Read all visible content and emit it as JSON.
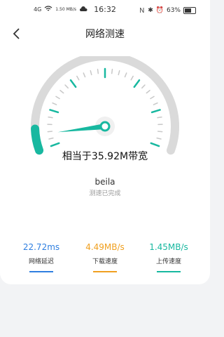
{
  "status_bar": {
    "signal": "4G",
    "net_speed": "1.50 MB/s",
    "time": "16:32",
    "icons": [
      "nfc-icon",
      "bluetooth-icon",
      "alarm-icon"
    ],
    "battery": "63%"
  },
  "header": {
    "title": "网络测速",
    "back_icon": "back-arrow-icon"
  },
  "gauge": {
    "speed_text": "相当于35.92M带宽",
    "progress_color": "#18b8a0",
    "track_color": "#dadada"
  },
  "device": {
    "name": "beila",
    "status": "测速已完成"
  },
  "stats": [
    {
      "value": "22.72ms",
      "label": "网络延迟",
      "color": "#2f7fe0"
    },
    {
      "value": "4.49MB/s",
      "label": "下载速度",
      "color": "#f0a020"
    },
    {
      "value": "1.45MB/s",
      "label": "上传速度",
      "color": "#18b8a0"
    }
  ]
}
